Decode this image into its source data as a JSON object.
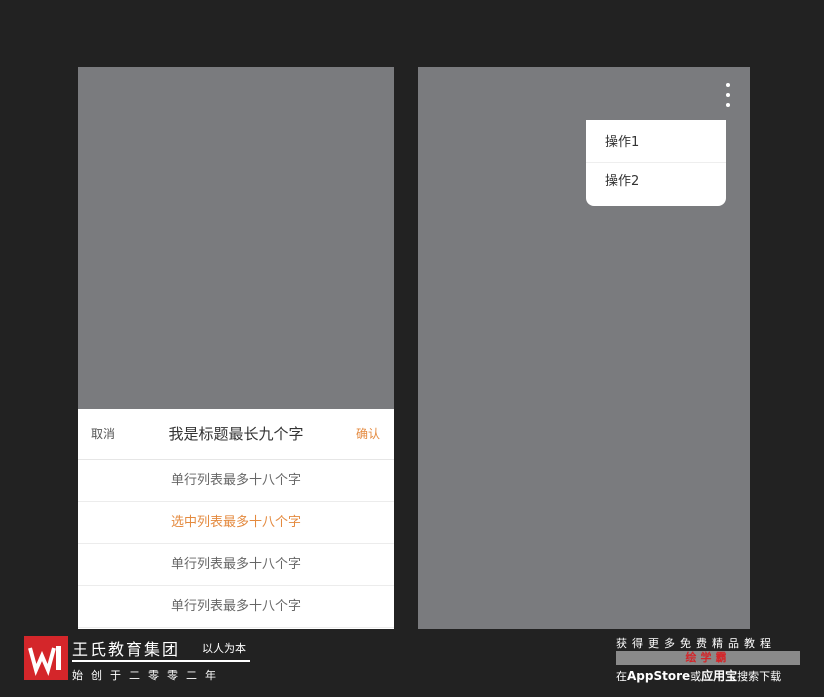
{
  "left_screen": {
    "sheet": {
      "cancel_label": "取消",
      "title": "我是标题最长九个字",
      "confirm_label": "确认",
      "items": [
        {
          "label": "单行列表最多十八个字",
          "selected": false
        },
        {
          "label": "选中列表最多十八个字",
          "selected": true
        },
        {
          "label": "单行列表最多十八个字",
          "selected": false
        },
        {
          "label": "单行列表最多十八个字",
          "selected": false
        }
      ]
    }
  },
  "right_screen": {
    "more_icon": "more-vertical-icon",
    "popup": {
      "items": [
        {
          "label": "操作1"
        },
        {
          "label": "操作2"
        }
      ]
    }
  },
  "footer": {
    "brand": {
      "logo_icon": "wang-logo-icon",
      "name": "王氏教育集团",
      "slogan": "以人为本",
      "founded": "始创于二零零二年"
    },
    "promo": {
      "line1": "获得更多免费精品教程",
      "highlight": "绘学霸",
      "line3_prefix": "在",
      "line3_store1": "AppStore",
      "line3_or": "或",
      "line3_store2": "应用宝",
      "line3_suffix": "搜索下载"
    }
  },
  "colors": {
    "background": "#222222",
    "screen": "#7a7b7e",
    "accent": "#e48a3f",
    "brand_red": "#d4262a"
  }
}
